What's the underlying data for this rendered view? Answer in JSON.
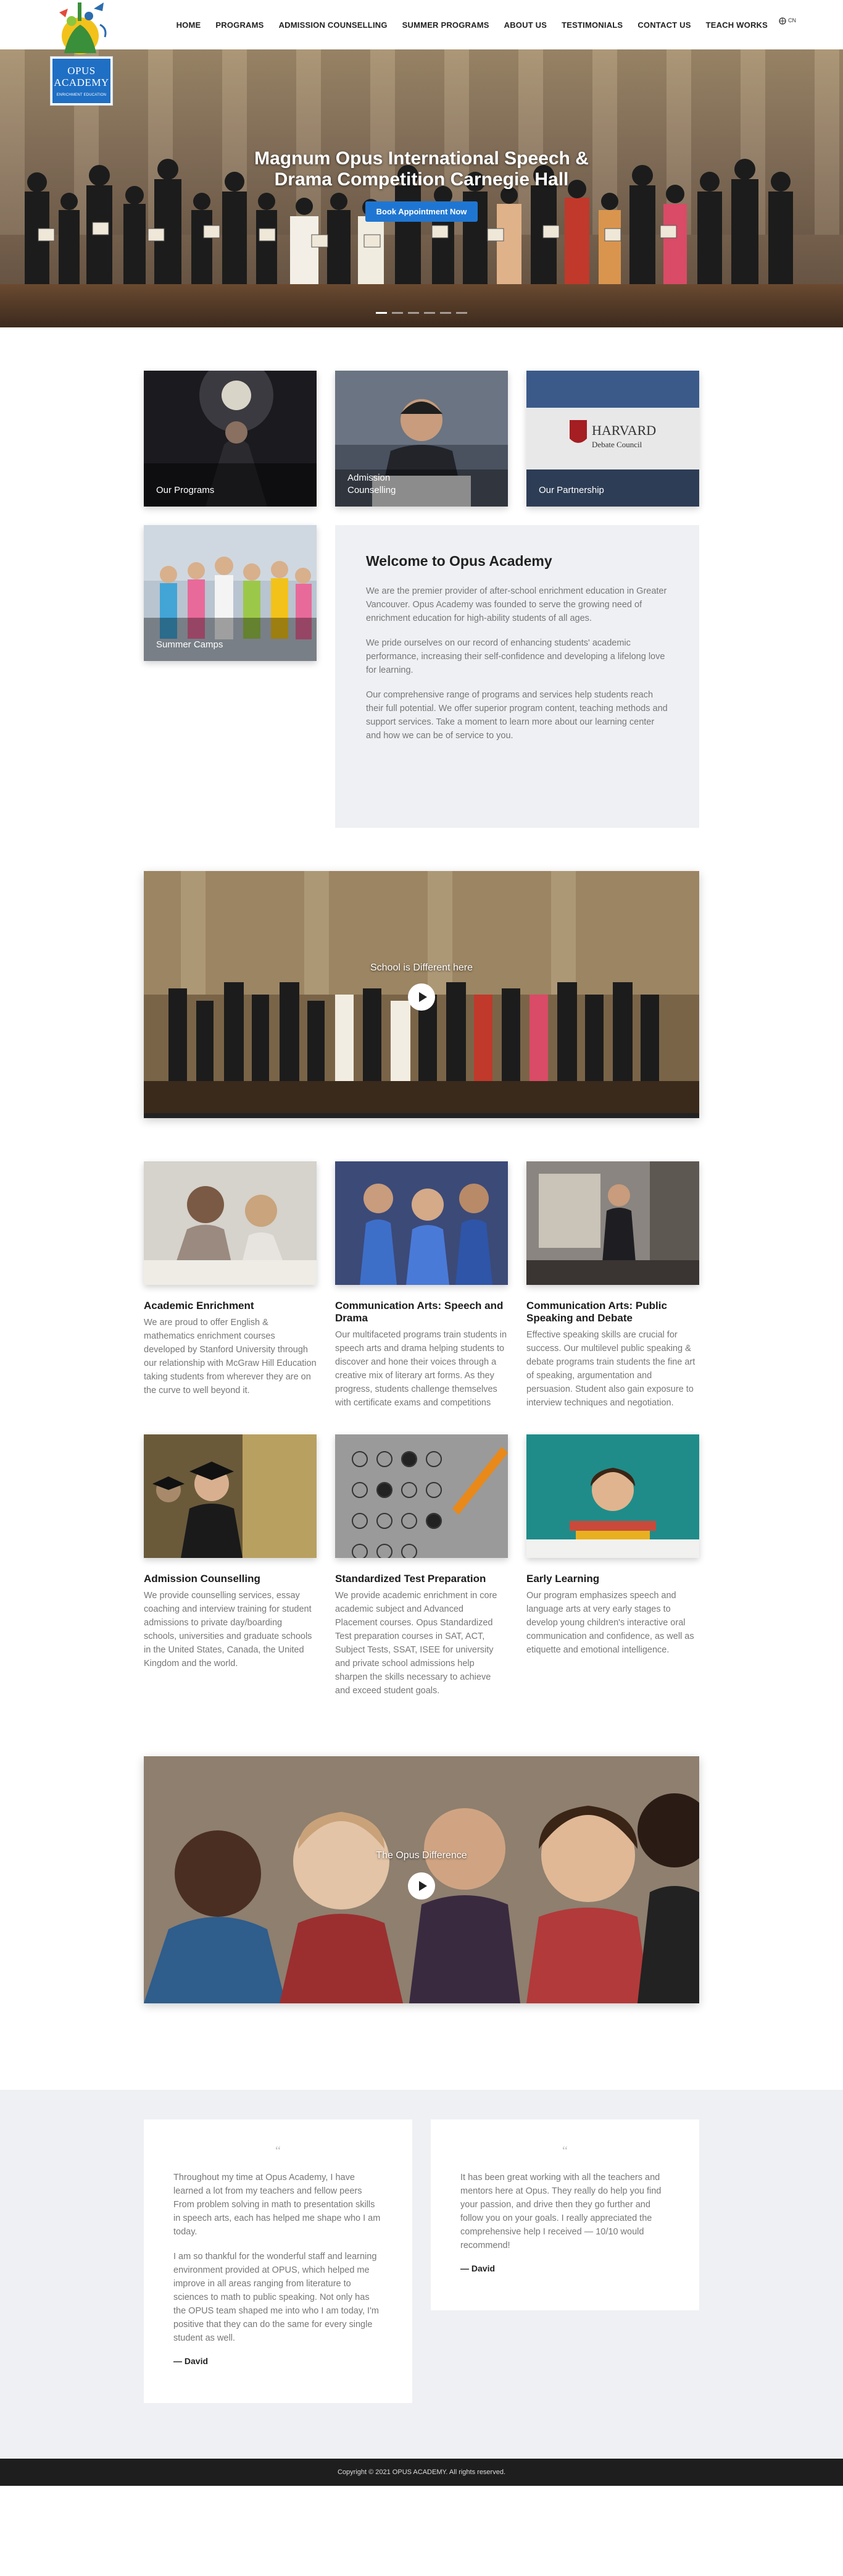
{
  "logo": {
    "line1": "OPUS",
    "line2": "ACADEMY",
    "tagline": "ENRICHMENT EDUCATION"
  },
  "nav": {
    "items": [
      {
        "label": "HOME"
      },
      {
        "label": "PROGRAMS"
      },
      {
        "label": "ADMISSION COUNSELLING"
      },
      {
        "label": "SUMMER PROGRAMS"
      },
      {
        "label": "ABOUT US"
      },
      {
        "label": "TESTIMONIALS"
      },
      {
        "label": "CONTACT US"
      },
      {
        "label": "TEACH WORKS"
      }
    ],
    "language": "CN"
  },
  "hero": {
    "title": "Magnum Opus International Speech & Drama Competition Carnegie Hall",
    "button": "Book Appointment Now",
    "slide_count": 6,
    "active_slide": 1
  },
  "tiles": [
    {
      "label": "Our Programs"
    },
    {
      "label": "Admission Counselling"
    },
    {
      "label": "Our Partnership",
      "image_text_1": "HARVARD",
      "image_text_2": "Debate Council"
    },
    {
      "label": "Summer Camps"
    }
  ],
  "welcome": {
    "title": "Welcome to Opus Academy",
    "paragraphs": [
      "We are the premier provider of after-school enrichment education in Greater Vancouver. Opus Academy was founded to serve the growing need of enrichment education for high-ability students of all ages.",
      "We pride ourselves on our record of enhancing students' academic performance, increasing their self-confidence and developing a lifelong love for learning.",
      "Our comprehensive range of programs and services help students reach their full potential. We offer superior program content, teaching methods and support services. Take a moment to learn more about our learning center and how we can be of service to you."
    ]
  },
  "video1": {
    "title": "School is Different here"
  },
  "programs": [
    {
      "title": "Academic Enrichment",
      "text": "We are proud to offer English & mathematics enrichment courses developed by Stanford University through our relationship with McGraw Hill Education taking students from wherever they are on the curve to well beyond it."
    },
    {
      "title": "Communication Arts: Speech and Drama",
      "text": "Our multifaceted programs train students in speech arts and drama helping students to discover and hone their voices through a creative mix of literary art forms. As they progress, students challenge themselves with certificate exams and competitions"
    },
    {
      "title": "Communication Arts: Public Speaking and Debate",
      "text": "Effective speaking skills are crucial for success. Our multilevel public speaking & debate programs train students the fine art of speaking, argumentation and persuasion. Student also gain exposure to interview techniques and negotiation."
    },
    {
      "title": "Admission Counselling",
      "text": "We provide counselling services, essay coaching and interview training for student admissions to private day/boarding schools, universities and graduate schools in the United States, Canada, the United Kingdom and the world."
    },
    {
      "title": "Standardized Test Preparation",
      "text": "We provide academic enrichment in core academic subject and Advanced Placement courses. Opus Standardized Test preparation courses in SAT, ACT, Subject Tests, SSAT, ISEE for university and private school admissions help sharpen the skills necessary to achieve and exceed student goals."
    },
    {
      "title": "Early Learning",
      "text": "Our program emphasizes speech and language arts at very early stages to develop young children's interactive oral communication and confidence, as well as etiquette and emotional intelligence."
    }
  ],
  "video2": {
    "title": "The Opus Difference"
  },
  "testimonials": [
    {
      "paragraphs": [
        "Throughout my time at Opus Academy, I have learned a lot from my teachers and fellow peers From problem solving in math to presentation skills in speech arts, each has helped me shape who I am today.",
        "I am so thankful for the wonderful staff and learning environment provided at OPUS, which helped me improve in all areas ranging from literature to sciences to math to public speaking. Not only has the OPUS team shaped me into who I am today, I'm positive that they can do the same for every single student as well."
      ],
      "author": "— David"
    },
    {
      "paragraphs": [
        "It has been great working with all the teachers and mentors here at Opus. They really do help you find your passion, and drive then they go further and follow you on your goals. I really appreciated the comprehensive help I received — 10/10 would recommend!"
      ],
      "author": "— David"
    }
  ],
  "footer": {
    "text": "Copyright © 2021 OPUS ACADEMY. All rights reserved."
  },
  "colors": {
    "brand_blue": "#1f76d2",
    "light_panel": "#eef0f3",
    "footer_bg": "#1e1e1e"
  }
}
